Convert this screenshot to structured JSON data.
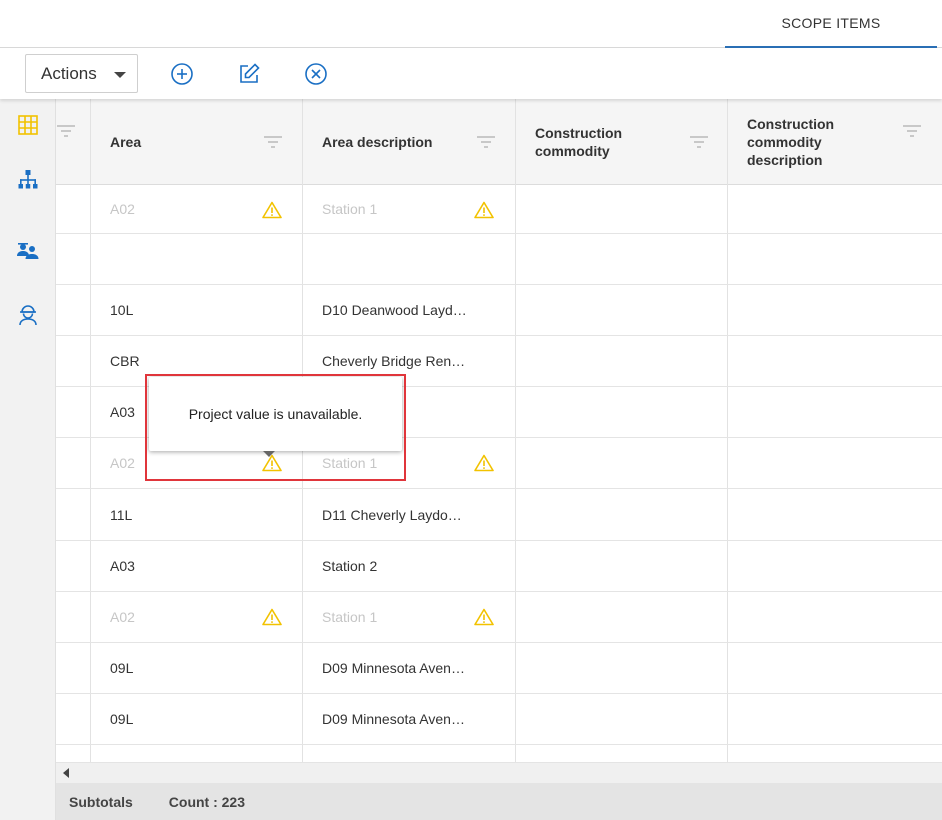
{
  "header": {
    "tab_label": "SCOPE ITEMS"
  },
  "toolbar": {
    "actions_label": "Actions",
    "buttons": [
      "add-circle-icon",
      "edit-icon",
      "cancel-circle-icon"
    ]
  },
  "sidebar": {
    "items": [
      "grid-icon",
      "hierarchy-icon",
      "people-group-icon",
      "worker-icon"
    ]
  },
  "columns": [
    "Area",
    "Area description",
    "Construction commodity",
    "Construction commodity description"
  ],
  "rows": [
    {
      "area": "A02",
      "desc": "Station 1",
      "commodity": "",
      "commodity_desc": "",
      "warning": true
    },
    {
      "area": "",
      "desc": "",
      "commodity": "",
      "commodity_desc": "",
      "warning": false
    },
    {
      "area": "10L",
      "desc": "D10 Deanwood Layd…",
      "commodity": "",
      "commodity_desc": "",
      "warning": false
    },
    {
      "area": "CBR",
      "desc": "Cheverly Bridge Ren…",
      "commodity": "",
      "commodity_desc": "",
      "warning": false
    },
    {
      "area": "A03",
      "desc": "",
      "commodity": "",
      "commodity_desc": "",
      "warning": false
    },
    {
      "area": "A02",
      "desc": "Station 1",
      "commodity": "",
      "commodity_desc": "",
      "warning": true
    },
    {
      "area": "11L",
      "desc": "D11 Cheverly Laydo…",
      "commodity": "",
      "commodity_desc": "",
      "warning": false
    },
    {
      "area": "A03",
      "desc": "Station 2",
      "commodity": "",
      "commodity_desc": "",
      "warning": false
    },
    {
      "area": "A02",
      "desc": "Station 1",
      "commodity": "",
      "commodity_desc": "",
      "warning": true
    },
    {
      "area": "09L",
      "desc": "D09 Minnesota Aven…",
      "commodity": "",
      "commodity_desc": "",
      "warning": false
    },
    {
      "area": "09L",
      "desc": "D09 Minnesota Aven…",
      "commodity": "",
      "commodity_desc": "",
      "warning": false
    }
  ],
  "footer": {
    "subtotals_label": "Subtotals",
    "count_label": "Count : 223"
  },
  "tooltip": {
    "text": "Project value is unavailable."
  },
  "colors": {
    "accent": "#1a6fc4",
    "warning": "#f2c200",
    "highlight": "#e0353b"
  }
}
